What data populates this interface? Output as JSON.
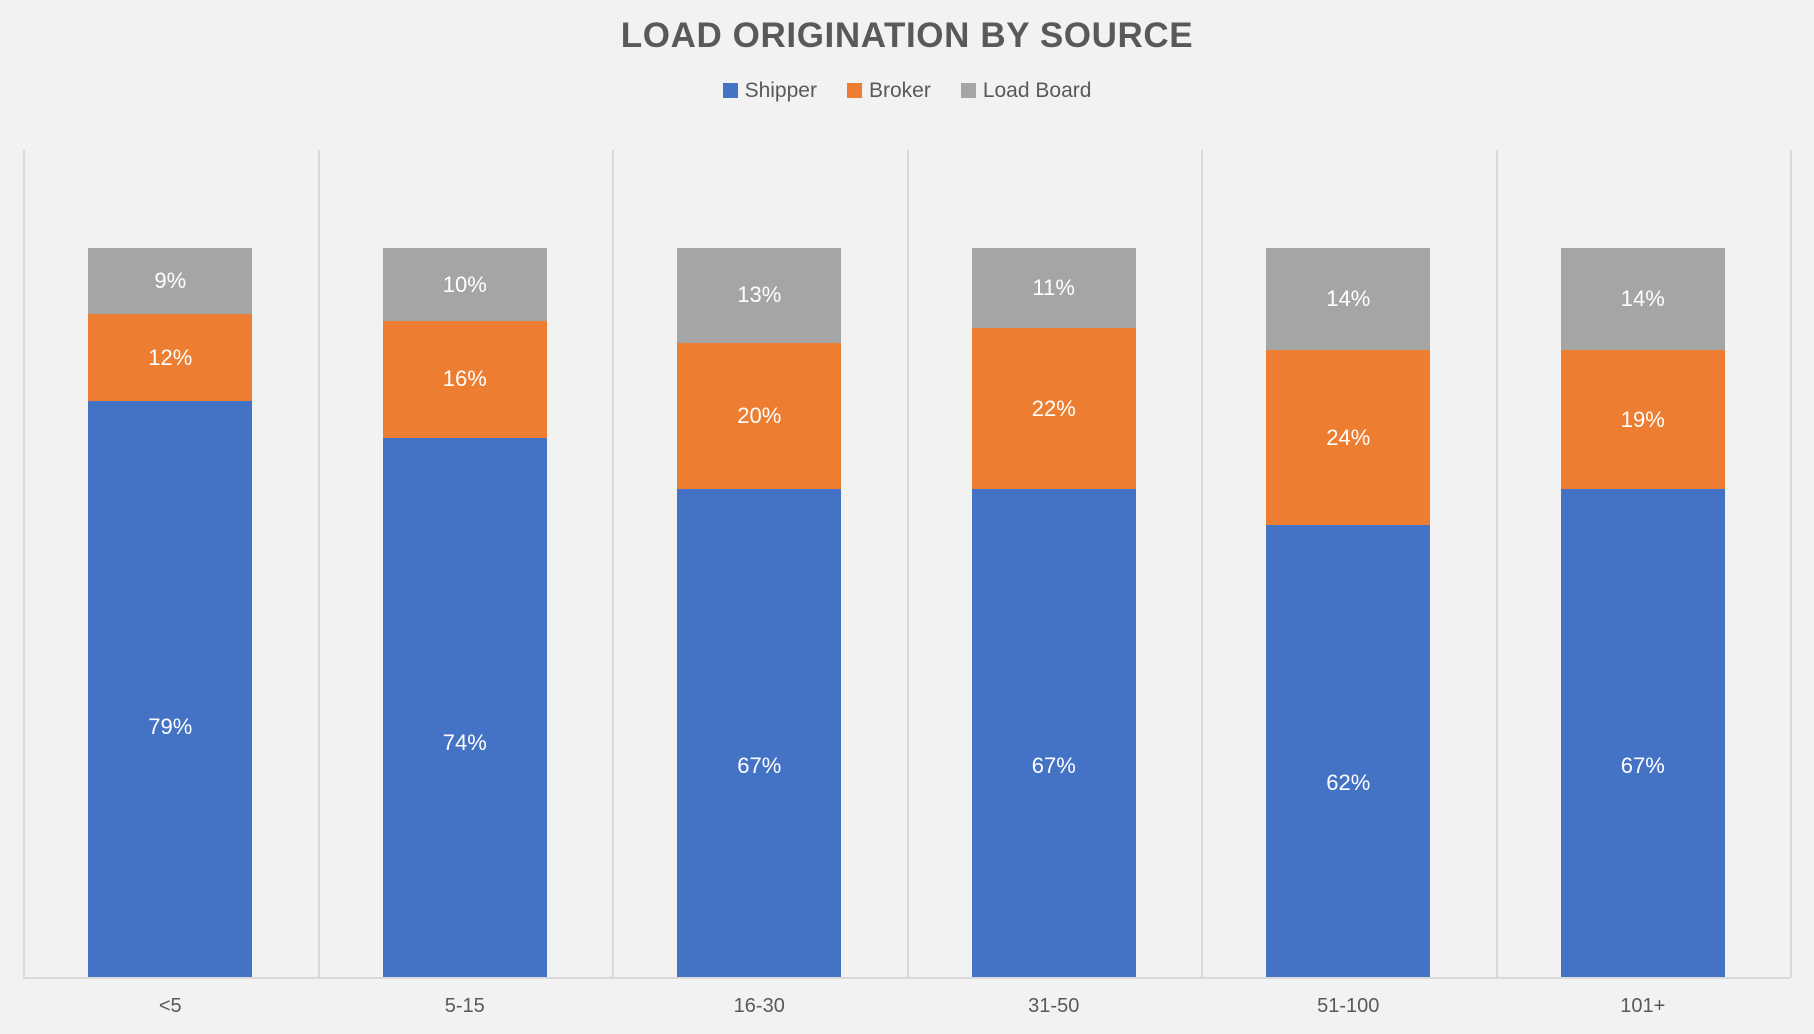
{
  "chart": {
    "title": "Load Origination by Source",
    "background_color": "#F2F2F2",
    "title_color": "#595959"
  },
  "legend": {
    "position": "top",
    "items": [
      {
        "label": "Shipper",
        "color": "#4472C4",
        "icon": "legend-swatch-square"
      },
      {
        "label": "Broker",
        "color": "#ED7D31",
        "icon": "legend-swatch-square"
      },
      {
        "label": "Load Board",
        "color": "#A5A5A5",
        "icon": "legend-swatch-square"
      }
    ]
  },
  "chart_data": {
    "type": "bar",
    "subtype": "stacked-column",
    "title": "LOAD ORIGINATION BY SOURCE",
    "subtitle": "",
    "xlabel": "",
    "ylabel": "",
    "ylim": [
      0,
      100
    ],
    "grid": "vertical-category-separators",
    "legend_position": "top",
    "value_suffix": "%",
    "categories": [
      "<5",
      "5-15",
      "16-30",
      "31-50",
      "51-100",
      "101+"
    ],
    "series": [
      {
        "name": "Shipper",
        "color": "#4472C4",
        "values": [
          79,
          74,
          67,
          67,
          62,
          67
        ]
      },
      {
        "name": "Broker",
        "color": "#ED7D31",
        "values": [
          12,
          16,
          20,
          22,
          24,
          19
        ]
      },
      {
        "name": "Load Board",
        "color": "#A5A5A5",
        "values": [
          9,
          10,
          13,
          11,
          14,
          14
        ]
      }
    ],
    "data_labels": {
      "Shipper": [
        "79%",
        "74%",
        "67%",
        "67%",
        "62%",
        "67%"
      ],
      "Broker": [
        "12%",
        "16%",
        "20%",
        "22%",
        "24%",
        "19%"
      ],
      "Load Board": [
        "9%",
        "10%",
        "13%",
        "11%",
        "14%",
        "14%"
      ]
    },
    "totals": [
      100,
      100,
      100,
      100,
      100,
      100
    ]
  }
}
